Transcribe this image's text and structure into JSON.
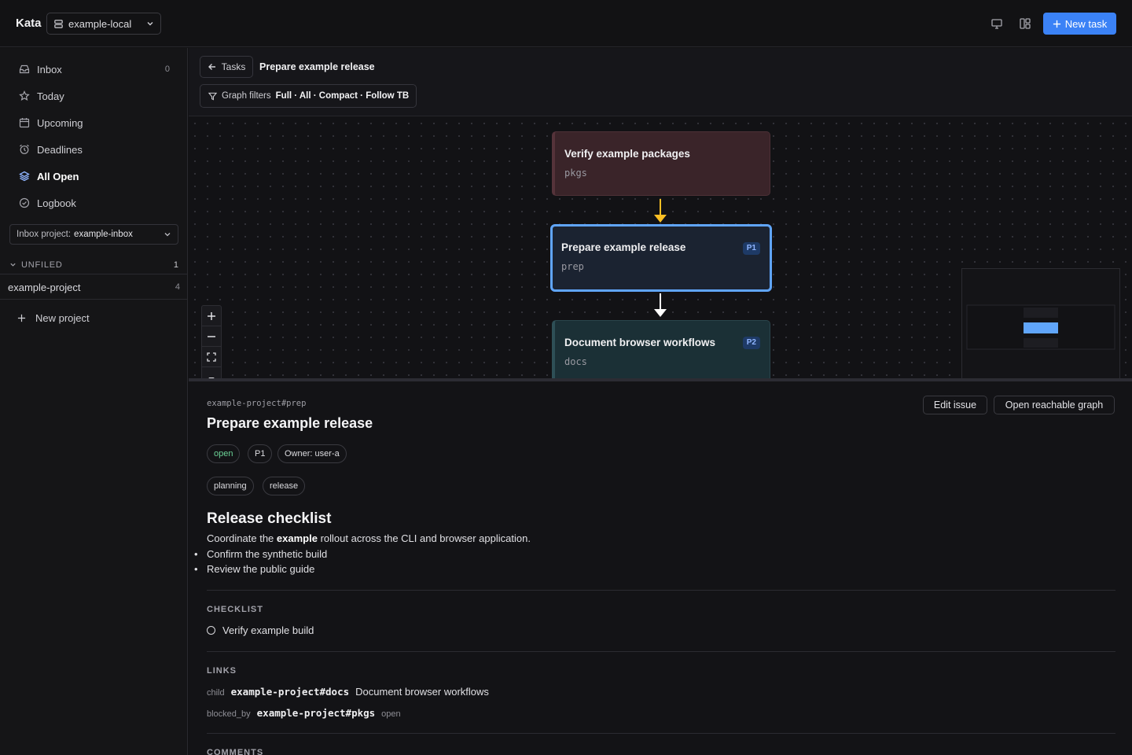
{
  "app": {
    "brand": "Kata",
    "workspace": "example-local",
    "new_task_label": "New task",
    "accent": "#3b82f6"
  },
  "sidebar": {
    "items": [
      {
        "label": "Inbox",
        "icon": "inbox-icon",
        "count": "0"
      },
      {
        "label": "Today",
        "icon": "star-icon",
        "count": ""
      },
      {
        "label": "Upcoming",
        "icon": "calendar-icon",
        "count": ""
      },
      {
        "label": "Deadlines",
        "icon": "alarm-clock-icon",
        "count": ""
      },
      {
        "label": "All Open",
        "icon": "layers-icon",
        "count": "",
        "active": true
      },
      {
        "label": "Logbook",
        "icon": "check-circle-icon",
        "count": ""
      }
    ],
    "inbox_project": {
      "prefix": "Inbox project:",
      "value": "example-inbox"
    },
    "unfiled": {
      "label": "UNFILED",
      "count": "1"
    },
    "projects": [
      {
        "name": "example-project",
        "count": "4"
      }
    ],
    "new_project_label": "New project"
  },
  "header": {
    "back_label": "Tasks",
    "title": "Prepare example release",
    "filters_label": "Graph filters",
    "filters_value": "Full · All · Compact · Follow TB"
  },
  "graph": {
    "nodes": [
      {
        "title": "Verify example packages",
        "slug": "pkgs",
        "priority": "",
        "status_color": "#3a2429"
      },
      {
        "title": "Prepare example release",
        "slug": "prep",
        "priority": "P1",
        "selected": true,
        "status_color": "#1b2331"
      },
      {
        "title": "Document browser workflows",
        "slug": "docs",
        "priority": "P2",
        "status_color": "#1b3036"
      }
    ],
    "edge_colors": [
      "#fbbf24",
      "#ffffff"
    ]
  },
  "detail": {
    "id": "example-project#prep",
    "title": "Prepare example release",
    "edit_label": "Edit issue",
    "graph_label": "Open reachable graph",
    "chips": [
      "open",
      "P1",
      "Owner: user-a"
    ],
    "labels": [
      "planning",
      "release"
    ],
    "body": {
      "heading": "Release checklist",
      "p_before": "Coordinate the ",
      "p_bold": "example",
      "p_after": " rollout across the CLI and browser application.",
      "bullets": [
        "Confirm the synthetic build",
        "Review the public guide"
      ]
    },
    "checklist_label": "CHECKLIST",
    "checklist": [
      {
        "text": "Verify example build",
        "done": false
      }
    ],
    "links_label": "LINKS",
    "links": [
      {
        "kind": "child",
        "ref": "example-project#docs",
        "text": "Document browser workflows"
      },
      {
        "kind": "blocked_by",
        "ref": "example-project#pkgs",
        "text": "open"
      }
    ],
    "comments_label": "COMMENTS"
  }
}
